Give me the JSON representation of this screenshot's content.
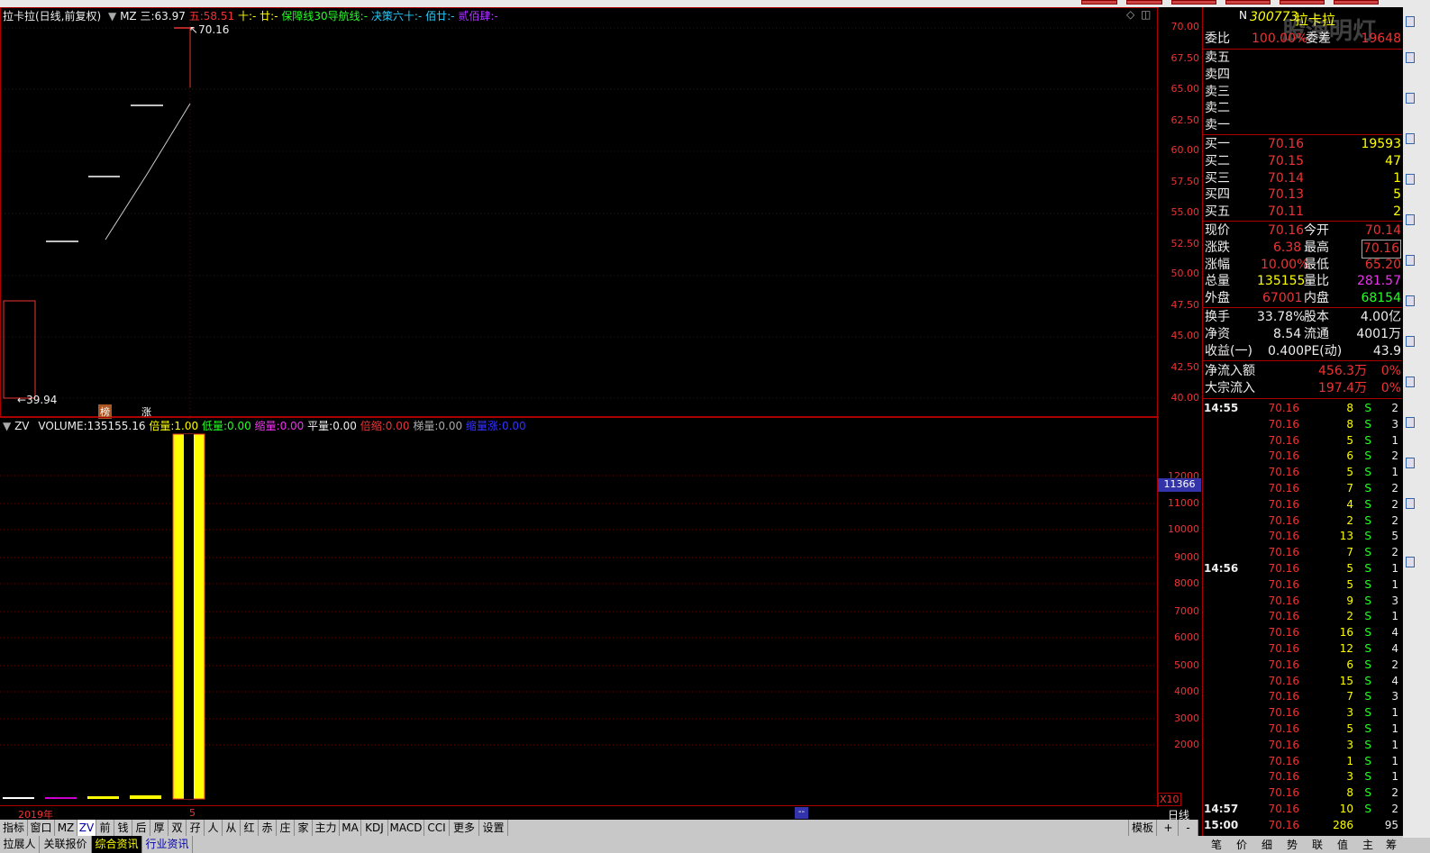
{
  "header": {
    "stock_title": "拉卡拉(日线,前复权)",
    "mz_label": "MZ",
    "ma3_label": "三:",
    "ma3_value": "63.97",
    "ma5_label": "五:",
    "ma5_value": "58.51",
    "ma10_label": "十:",
    "ma10_value": "-",
    "ma20_label": "廿:",
    "ma20_value": "-",
    "guard_label": "保障线30导航线:",
    "guard_value": "-",
    "decision_label": "决策六十:",
    "decision_value": "-",
    "hundred_label": "佰廿:",
    "hundred_value": "-",
    "doublepeak_label": "贰佰肆:",
    "doublepeak_value": "-"
  },
  "main_chart": {
    "high_label": "70.16",
    "low_label": "39.94",
    "badge_rank": "榜",
    "badge_up": "涨",
    "price_ticks": [
      "70.00",
      "67.50",
      "65.00",
      "62.50",
      "60.00",
      "57.50",
      "55.00",
      "52.50",
      "50.00",
      "47.50",
      "45.00",
      "42.50",
      "40.00"
    ]
  },
  "volume_chart": {
    "indicator": "ZV",
    "volume_label": "VOLUME:",
    "volume_value": "135155.16",
    "beiliang_label": "倍量:",
    "beiliang_value": "1.00",
    "diliang_label": "低量:",
    "diliang_value": "0.00",
    "shouliang_label": "缩量:",
    "shouliang_value": "0.00",
    "pingliang_label": "平量:",
    "pingliang_value": "0.00",
    "beisuo_label": "倍缩:",
    "beisuo_value": "0.00",
    "tiliang_label": "梯量:",
    "tiliang_value": "0.00",
    "suoliangzhang_label": "缩量涨:",
    "suoliangzhang_value": "0.00",
    "vol_ticks": [
      "12000",
      "11000",
      "10000",
      "9000",
      "8000",
      "7000",
      "6000",
      "5000",
      "4000",
      "3000",
      "2000"
    ],
    "cursor_value": "11366",
    "multiplier": "X10"
  },
  "date_axis": {
    "year": "2019年",
    "month": "5",
    "cursor_marker": "--",
    "period": "日线"
  },
  "tabs": [
    "指标",
    "窗口",
    "MZ",
    "ZV",
    "前",
    "钱",
    "后",
    "厚",
    "双",
    "孖",
    "人",
    "从",
    "红",
    "赤",
    "庄",
    "家",
    "主力",
    "MA",
    "KDJ",
    "MACD",
    "CCI",
    "更多",
    "设置"
  ],
  "tabs_right": [
    "模板",
    "+",
    "-"
  ],
  "bottom_strip": [
    "拉展人",
    "关联报价",
    "综合资讯",
    "行业资讯"
  ],
  "quote": {
    "code": "300773",
    "name": "拉卡拉",
    "n_mark": "N",
    "weibi_label": "委比",
    "weibi_value": "100.00%",
    "weicha_label": "委差",
    "weicha_value": "19648",
    "watermark": "股海明灯",
    "sells": [
      {
        "label": "卖五",
        "price": "",
        "vol": ""
      },
      {
        "label": "卖四",
        "price": "",
        "vol": ""
      },
      {
        "label": "卖三",
        "price": "",
        "vol": ""
      },
      {
        "label": "卖二",
        "price": "",
        "vol": ""
      },
      {
        "label": "卖一",
        "price": "",
        "vol": ""
      }
    ],
    "buys": [
      {
        "label": "买一",
        "price": "70.16",
        "vol": "19593"
      },
      {
        "label": "买二",
        "price": "70.15",
        "vol": "47"
      },
      {
        "label": "买三",
        "price": "70.14",
        "vol": "1"
      },
      {
        "label": "买四",
        "price": "70.13",
        "vol": "5"
      },
      {
        "label": "买五",
        "price": "70.11",
        "vol": "2"
      }
    ],
    "stats": [
      {
        "l1": "现价",
        "v1": "70.16",
        "l2": "今开",
        "v2": "70.14"
      },
      {
        "l1": "涨跌",
        "v1": "6.38",
        "l2": "最高",
        "v2": "70.16"
      },
      {
        "l1": "涨幅",
        "v1": "10.00%",
        "l2": "最低",
        "v2": "65.20"
      },
      {
        "l1": "总量",
        "v1": "135155",
        "l2": "量比",
        "v2": "281.57"
      },
      {
        "l1": "外盘",
        "v1": "67001",
        "l2": "内盘",
        "v2": "68154"
      }
    ],
    "stats2": [
      {
        "l1": "换手",
        "v1": "33.78%",
        "l2": "股本",
        "v2": "4.00亿"
      },
      {
        "l1": "净资",
        "v1": "8.54",
        "l2": "流通",
        "v2": "4001万"
      },
      {
        "l1": "收益(一)",
        "v1": "0.400",
        "l2": "PE(动)",
        "v2": "43.9"
      }
    ],
    "flows": [
      {
        "label": "净流入额",
        "value": "456.3万",
        "pct": "0%"
      },
      {
        "label": "大宗流入",
        "value": "197.4万",
        "pct": "0%"
      }
    ],
    "ticks": [
      {
        "time": "14:55",
        "price": "70.16",
        "vol": "8",
        "bs": "S",
        "n": "2"
      },
      {
        "time": "",
        "price": "70.16",
        "vol": "8",
        "bs": "S",
        "n": "3"
      },
      {
        "time": "",
        "price": "70.16",
        "vol": "5",
        "bs": "S",
        "n": "1"
      },
      {
        "time": "",
        "price": "70.16",
        "vol": "6",
        "bs": "S",
        "n": "2"
      },
      {
        "time": "",
        "price": "70.16",
        "vol": "5",
        "bs": "S",
        "n": "1"
      },
      {
        "time": "",
        "price": "70.16",
        "vol": "7",
        "bs": "S",
        "n": "2"
      },
      {
        "time": "",
        "price": "70.16",
        "vol": "4",
        "bs": "S",
        "n": "2"
      },
      {
        "time": "",
        "price": "70.16",
        "vol": "2",
        "bs": "S",
        "n": "2"
      },
      {
        "time": "",
        "price": "70.16",
        "vol": "13",
        "bs": "S",
        "n": "5"
      },
      {
        "time": "",
        "price": "70.16",
        "vol": "7",
        "bs": "S",
        "n": "2"
      },
      {
        "time": "14:56",
        "price": "70.16",
        "vol": "5",
        "bs": "S",
        "n": "1"
      },
      {
        "time": "",
        "price": "70.16",
        "vol": "5",
        "bs": "S",
        "n": "1"
      },
      {
        "time": "",
        "price": "70.16",
        "vol": "9",
        "bs": "S",
        "n": "3"
      },
      {
        "time": "",
        "price": "70.16",
        "vol": "2",
        "bs": "S",
        "n": "1"
      },
      {
        "time": "",
        "price": "70.16",
        "vol": "16",
        "bs": "S",
        "n": "4"
      },
      {
        "time": "",
        "price": "70.16",
        "vol": "12",
        "bs": "S",
        "n": "4"
      },
      {
        "time": "",
        "price": "70.16",
        "vol": "6",
        "bs": "S",
        "n": "2"
      },
      {
        "time": "",
        "price": "70.16",
        "vol": "15",
        "bs": "S",
        "n": "4"
      },
      {
        "time": "",
        "price": "70.16",
        "vol": "7",
        "bs": "S",
        "n": "3"
      },
      {
        "time": "",
        "price": "70.16",
        "vol": "3",
        "bs": "S",
        "n": "1"
      },
      {
        "time": "",
        "price": "70.16",
        "vol": "5",
        "bs": "S",
        "n": "1"
      },
      {
        "time": "",
        "price": "70.16",
        "vol": "3",
        "bs": "S",
        "n": "1"
      },
      {
        "time": "",
        "price": "70.16",
        "vol": "1",
        "bs": "S",
        "n": "1"
      },
      {
        "time": "",
        "price": "70.16",
        "vol": "3",
        "bs": "S",
        "n": "1"
      },
      {
        "time": "",
        "price": "70.16",
        "vol": "8",
        "bs": "S",
        "n": "2"
      },
      {
        "time": "14:57",
        "price": "70.16",
        "vol": "10",
        "bs": "S",
        "n": "2"
      },
      {
        "time": "15:00",
        "price": "70.16",
        "vol": "286",
        "bs": "",
        "n": "95"
      }
    ],
    "bottom_tabs": [
      "笔",
      "价",
      "细",
      "势",
      "联",
      "值",
      "主",
      "筹"
    ]
  },
  "colors": {
    "up": "#ee3333",
    "yellow": "#ffff00",
    "green": "#22ff22",
    "axis": "#aa0000",
    "background": "#000000"
  }
}
